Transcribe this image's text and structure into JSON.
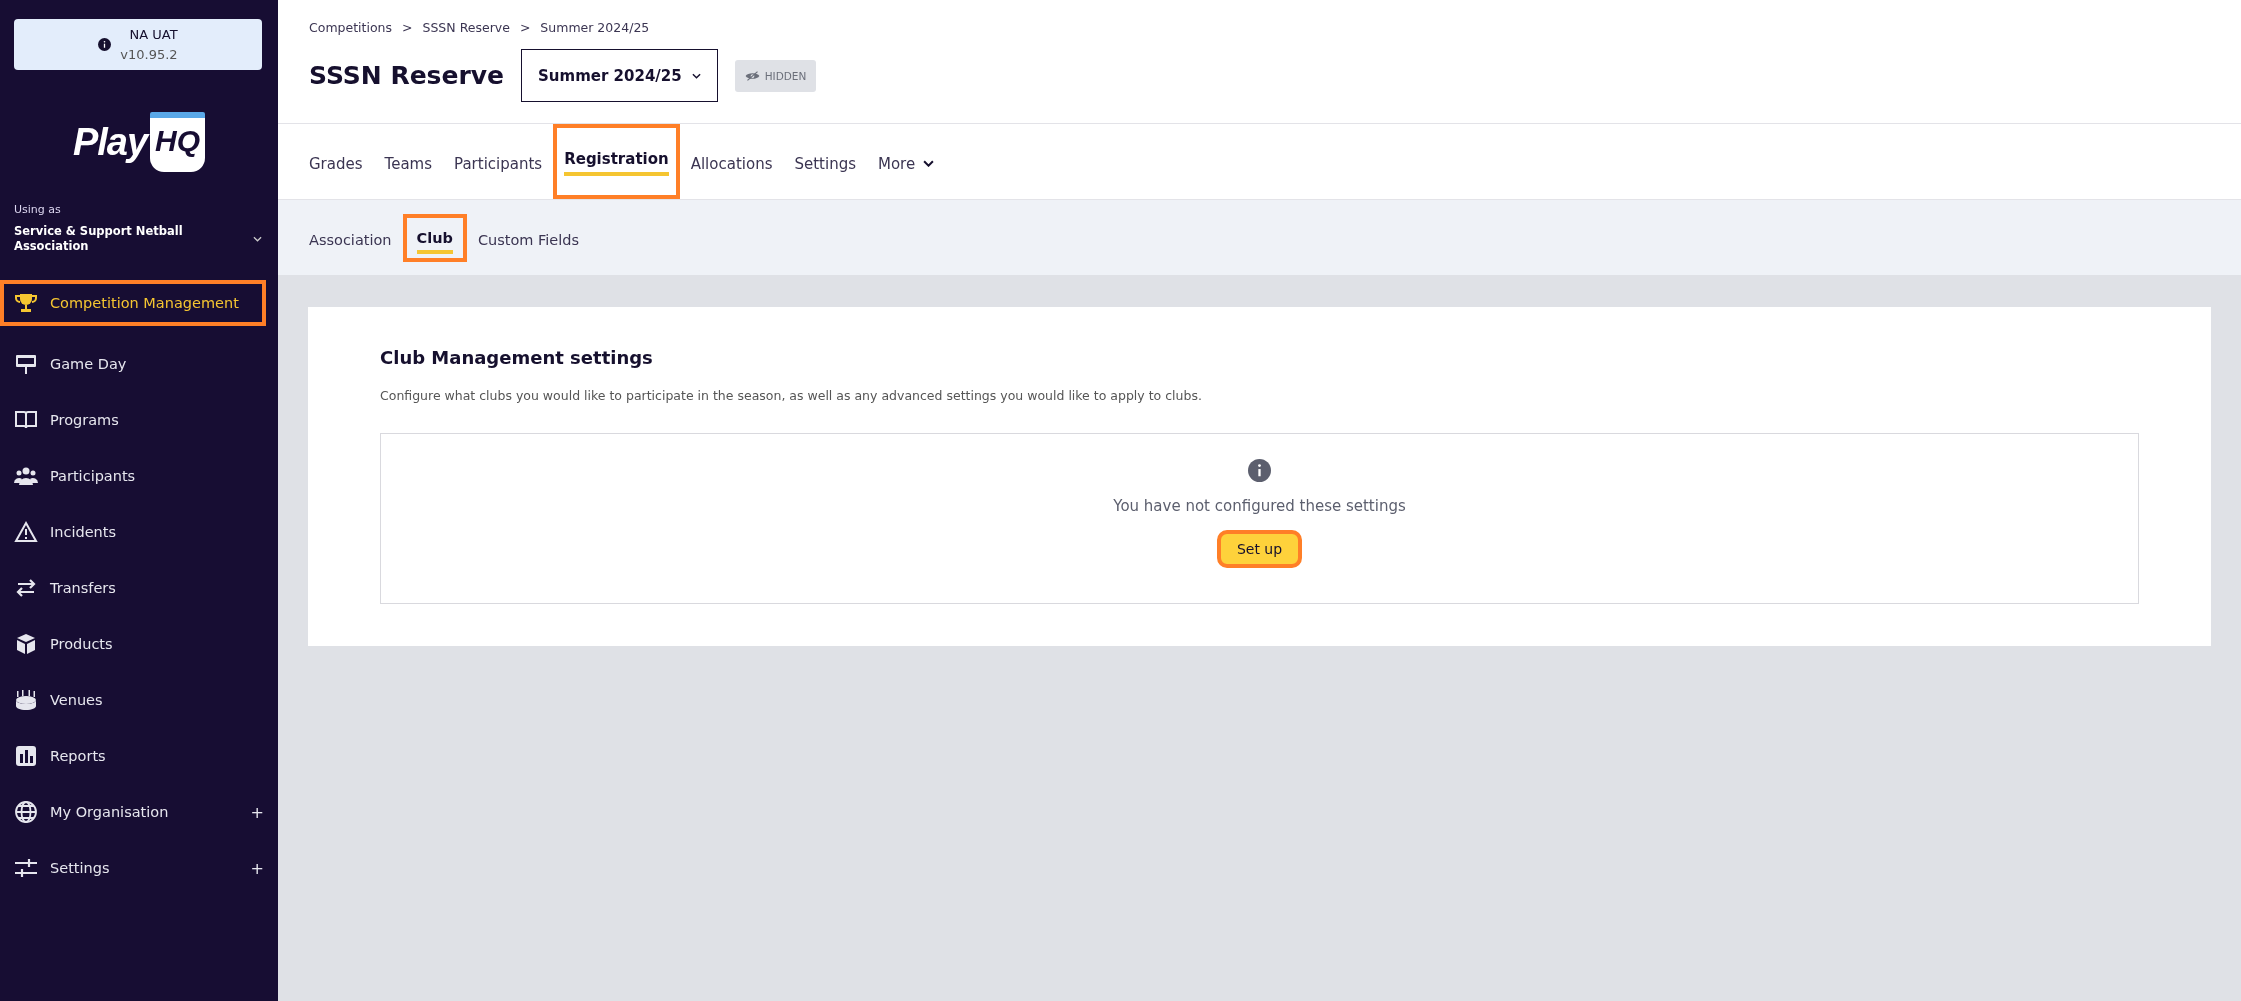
{
  "env_badge": {
    "name": "NA UAT",
    "version": "v10.95.2"
  },
  "logo": {
    "text": "Play",
    "mark": "HQ"
  },
  "org": {
    "label": "Using as",
    "name": "Service & Support Netball Association"
  },
  "sidebar": {
    "items": [
      {
        "label": "Competition Management",
        "selected": true,
        "highlighted": true
      },
      {
        "label": "Game Day",
        "selected": false,
        "highlighted": false
      },
      {
        "label": "Programs",
        "selected": false,
        "highlighted": false
      },
      {
        "label": "Participants",
        "selected": false,
        "highlighted": false
      },
      {
        "label": "Incidents",
        "selected": false,
        "highlighted": false
      },
      {
        "label": "Transfers",
        "selected": false,
        "highlighted": false
      },
      {
        "label": "Products",
        "selected": false,
        "highlighted": false
      },
      {
        "label": "Venues",
        "selected": false,
        "highlighted": false
      },
      {
        "label": "Reports",
        "selected": false,
        "highlighted": false
      },
      {
        "label": "My Organisation",
        "selected": false,
        "highlighted": false,
        "expander": "+"
      },
      {
        "label": "Settings",
        "selected": false,
        "highlighted": false,
        "expander": "+"
      }
    ]
  },
  "breadcrumb": [
    "Competitions",
    "SSSN Reserve",
    "Summer 2024/25"
  ],
  "breadcrumb_separator": ">",
  "title": "SSSN Reserve",
  "season_dropdown": {
    "value": "Summer 2024/25"
  },
  "visibility_badge": "HIDDEN",
  "tabs": [
    {
      "label": "Grades",
      "selected": false,
      "highlighted": false
    },
    {
      "label": "Teams",
      "selected": false,
      "highlighted": false
    },
    {
      "label": "Participants",
      "selected": false,
      "highlighted": false
    },
    {
      "label": "Registration",
      "selected": true,
      "highlighted": true
    },
    {
      "label": "Allocations",
      "selected": false,
      "highlighted": false
    },
    {
      "label": "Settings",
      "selected": false,
      "highlighted": false
    },
    {
      "label": "More",
      "selected": false,
      "highlighted": false
    }
  ],
  "subtabs": [
    {
      "label": "Association",
      "selected": false,
      "highlighted": false
    },
    {
      "label": "Club",
      "selected": true,
      "highlighted": true
    },
    {
      "label": "Custom Fields",
      "selected": false,
      "highlighted": false
    }
  ],
  "card": {
    "heading": "Club Management settings",
    "description": "Configure what clubs you would like to participate in the season, as well as any advanced settings you would like to apply to clubs.",
    "empty_state": {
      "message": "You have not configured these settings",
      "button": {
        "label": "Set up",
        "highlighted": true
      }
    }
  }
}
